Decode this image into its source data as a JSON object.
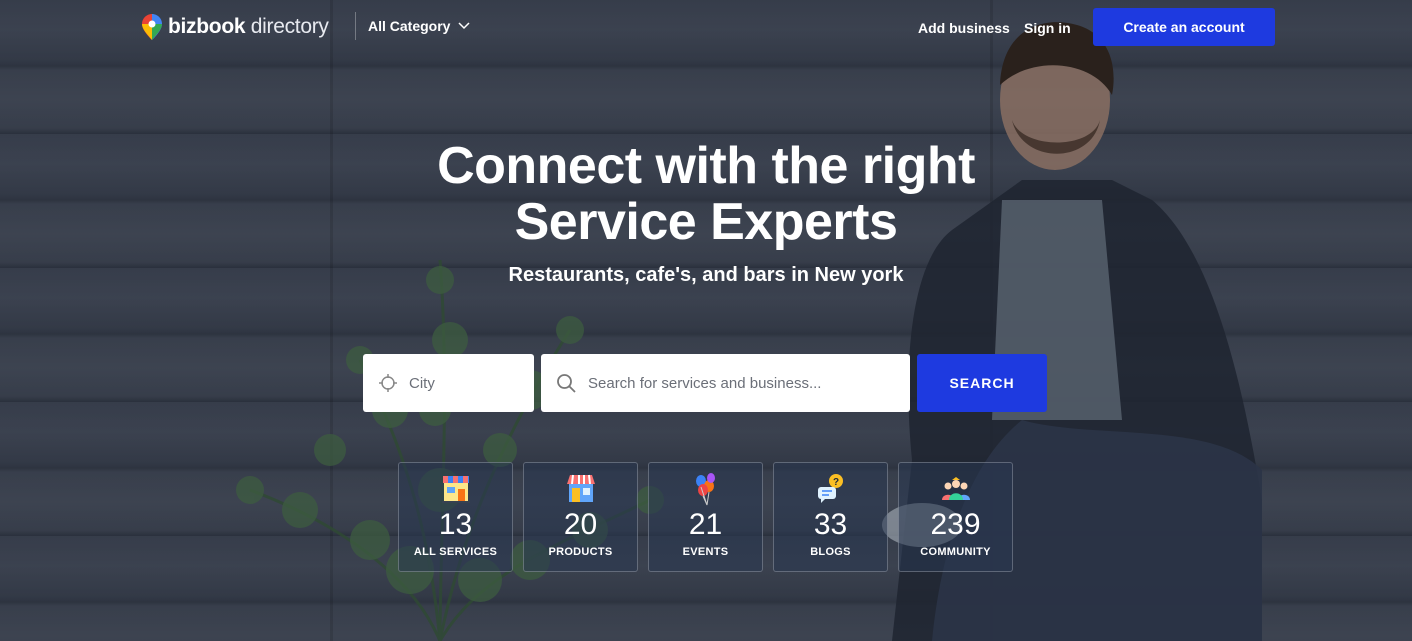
{
  "header": {
    "logo_brand": "bizbook",
    "logo_suffix": "directory",
    "category_label": "All Category",
    "add_business": "Add business",
    "sign_in": "Sign in",
    "create_account": "Create an account"
  },
  "hero": {
    "title_line1": "Connect with the right",
    "title_line2": "Service Experts",
    "subtitle": "Restaurants, cafe's, and bars in New york"
  },
  "search": {
    "city_placeholder": "City",
    "query_placeholder": "Search for services and business...",
    "button_label": "SEARCH"
  },
  "stats": [
    {
      "count": "13",
      "label": "ALL SERVICES",
      "icon": "storefront-icon"
    },
    {
      "count": "20",
      "label": "PRODUCTS",
      "icon": "shop-icon"
    },
    {
      "count": "21",
      "label": "EVENTS",
      "icon": "balloons-icon"
    },
    {
      "count": "33",
      "label": "BLOGS",
      "icon": "chat-question-icon"
    },
    {
      "count": "239",
      "label": "COMMUNITY",
      "icon": "community-icon"
    }
  ],
  "colors": {
    "accent": "#1e3ae0",
    "text": "#ffffff"
  }
}
